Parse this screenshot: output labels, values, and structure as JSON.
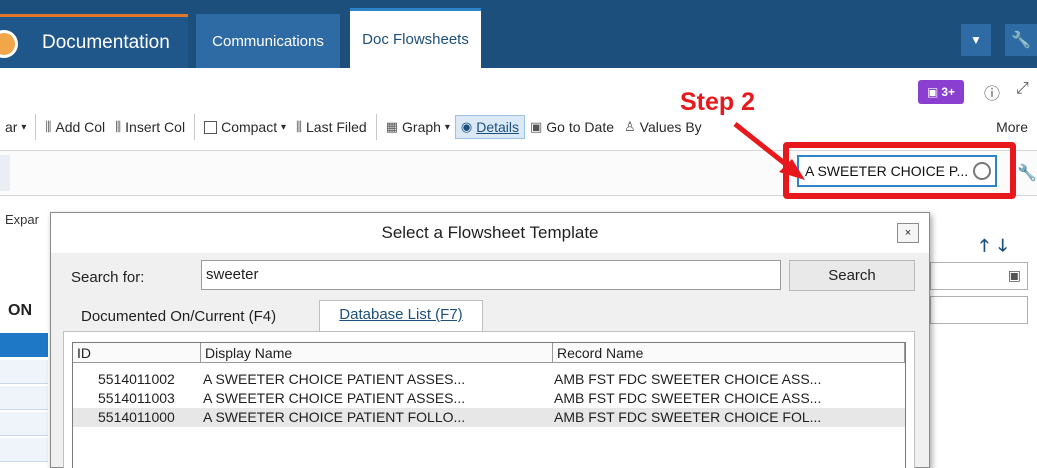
{
  "nav": {
    "tabs": [
      {
        "label": "Documentation"
      },
      {
        "label": "Communications"
      },
      {
        "label": "Doc Flowsheets"
      }
    ]
  },
  "toolbar": {
    "items": [
      {
        "label": "ar"
      },
      {
        "label": "Add Col"
      },
      {
        "label": "Insert Col"
      },
      {
        "label": "Compact"
      },
      {
        "label": "Last Filed"
      },
      {
        "label": "Graph"
      },
      {
        "label": "Details"
      },
      {
        "label": "Go to Date"
      },
      {
        "label": "Values By"
      },
      {
        "label": "More"
      }
    ]
  },
  "media_badge": "3+",
  "flowsheet_search": {
    "value": "A SWEETER CHOICE P..."
  },
  "annotation": {
    "step_label": "Step 2"
  },
  "background": {
    "left_text": "Expar",
    "column_label": "ON"
  },
  "dialog": {
    "title": "Select a Flowsheet Template",
    "close_label": "×",
    "search_label": "Search for:",
    "search_value": "sweeter",
    "search_button": "Search",
    "tabs": [
      "Documented On/Current (F4)",
      "Database List (F7)"
    ],
    "columns": [
      "ID",
      "Display Name",
      "Record Name"
    ],
    "rows": [
      {
        "id": "5514011002",
        "display": "A SWEETER CHOICE PATIENT ASSES...",
        "record": "AMB FST FDC SWEETER CHOICE ASS..."
      },
      {
        "id": "5514011003",
        "display": "A SWEETER CHOICE PATIENT ASSES...",
        "record": "AMB FST FDC SWEETER CHOICE ASS..."
      },
      {
        "id": "5514011000",
        "display": "A SWEETER CHOICE PATIENT FOLLO...",
        "record": "AMB FST FDC SWEETER CHOICE FOL..."
      }
    ]
  },
  "colors": {
    "nav": "#1d4f7c",
    "highlight": "#e8191c",
    "accent": "#2e84c8"
  }
}
